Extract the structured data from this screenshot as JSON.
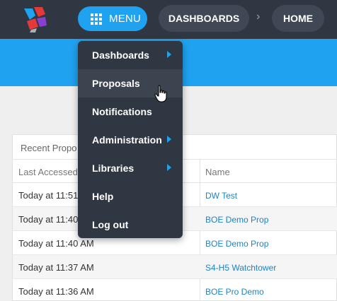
{
  "header": {
    "menu_label": "MENU",
    "breadcrumbs": [
      "DASHBOARDS",
      "HOME"
    ],
    "separator": "›"
  },
  "card": {
    "title": "Recent Propo",
    "columns": [
      "Last Accessed",
      "Name"
    ],
    "rows": [
      {
        "accessed": "Today at 11:51",
        "name": "DW Test"
      },
      {
        "accessed": "Today at 11:40",
        "name": "BOE Demo Prop"
      },
      {
        "accessed": "Today at 11:40 AM",
        "name": "BOE Demo Prop"
      },
      {
        "accessed": "Today at 11:37 AM",
        "name": "S4-H5 Watchtower"
      },
      {
        "accessed": "Today at 11:36 AM",
        "name": "BOE Pro Demo"
      }
    ]
  },
  "menu": {
    "items": [
      {
        "label": "Dashboards",
        "submenu": true
      },
      {
        "label": "Proposals",
        "submenu": false,
        "hovered": true
      },
      {
        "label": "Notifications",
        "submenu": false
      },
      {
        "label": "Administration",
        "submenu": true
      },
      {
        "label": "Libraries",
        "submenu": true
      },
      {
        "label": "Help",
        "submenu": false
      },
      {
        "label": "Log out",
        "submenu": false
      }
    ]
  },
  "colors": {
    "topbar": "#2f3742",
    "accent": "#1fa2f0",
    "link": "#1a84c6"
  },
  "icons": [
    "app-logo-icon",
    "grid-menu-icon",
    "chevron-right-icon",
    "hand-pointer-cursor-icon"
  ]
}
